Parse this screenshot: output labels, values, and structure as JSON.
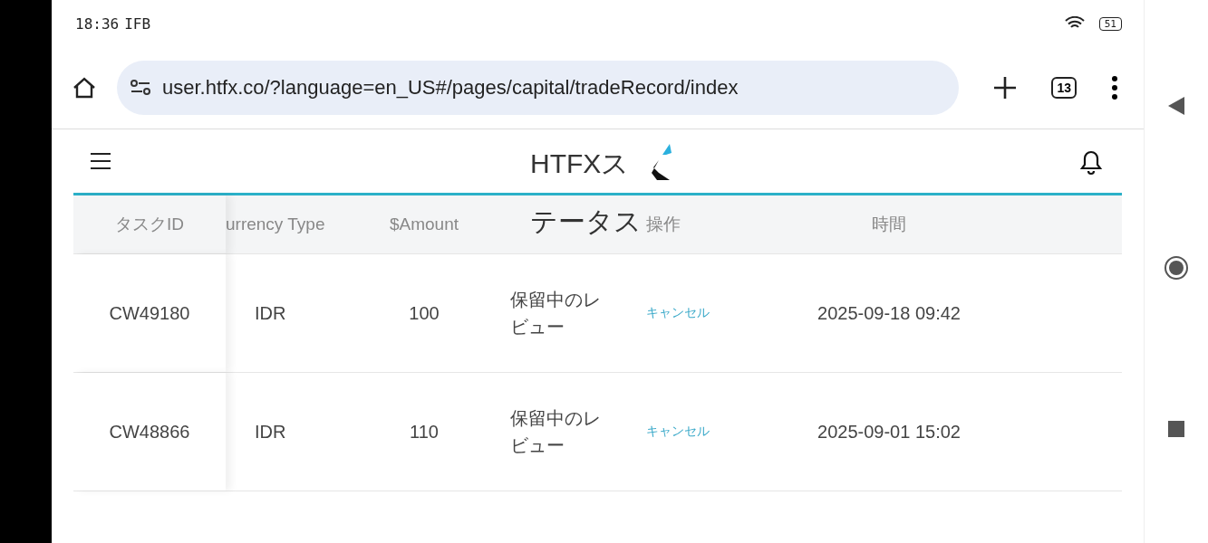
{
  "status_bar": {
    "time": "18:36",
    "carrier": "IFB",
    "battery": "51"
  },
  "browser": {
    "url": "user.htfx.co/?language=en_US#/pages/capital/tradeRecord/index",
    "tab_count": "13"
  },
  "app_header": {
    "title": "HTFXステータス"
  },
  "table": {
    "columns": [
      "タスクID",
      "urrency Type",
      "$Amount",
      "",
      "操作",
      "時間"
    ],
    "rows": [
      {
        "id": "CW49180",
        "currency": "IDR",
        "amount": "100",
        "status": "保留中のレビュー",
        "action": "キャンセル",
        "time": "2025-09-18 09:42"
      },
      {
        "id": "CW48866",
        "currency": "IDR",
        "amount": "110",
        "status": "保留中のレビュー",
        "action": "キャンセル",
        "time": "2025-09-01 15:02"
      }
    ]
  }
}
